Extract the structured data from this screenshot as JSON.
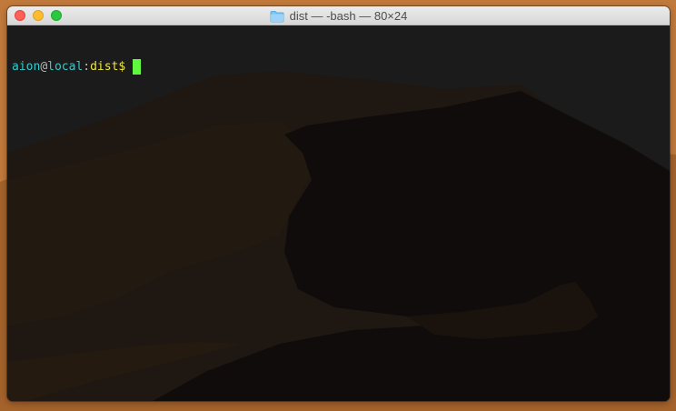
{
  "window": {
    "title": "dist — -bash — 80×24",
    "title_icon": "folder-icon",
    "controls": [
      "close",
      "minimize",
      "zoom"
    ]
  },
  "terminal": {
    "prompt": {
      "user": "aion",
      "at": "@",
      "host": "local",
      "colon": ":",
      "directory": "dist",
      "symbol": "$"
    },
    "cursor_visible": true
  },
  "colors": {
    "user": "#33c9c9",
    "directory": "#f0e63d",
    "cursor": "#5ff73f",
    "terminal_bg": "#1c1c1c",
    "close": "#fe5f57",
    "minimize": "#febc2e",
    "zoom": "#28c840"
  }
}
